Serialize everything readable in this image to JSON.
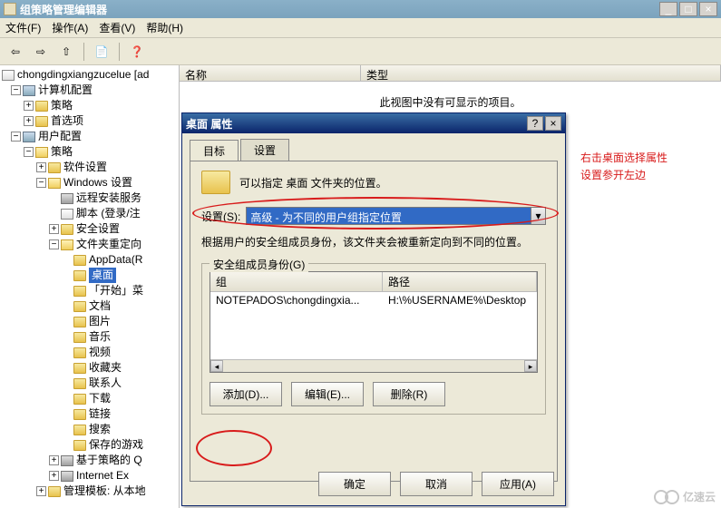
{
  "app": {
    "title": "组策略管理编辑器"
  },
  "menu": {
    "file": "文件(F)",
    "action": "操作(A)",
    "view": "查看(V)",
    "help": "帮助(H)"
  },
  "tree": {
    "root": "chongdingxiangzucelue [ad",
    "computer_cfg": "计算机配置",
    "policies1": "策略",
    "prefs1": "首选项",
    "user_cfg": "用户配置",
    "policies2": "策略",
    "software": "软件设置",
    "windows": "Windows 设置",
    "remoteinst": "远程安装服务",
    "scripts": "脚本 (登录/注",
    "security": "安全设置",
    "folderredir": "文件夹重定向",
    "appdata": "AppData(R",
    "desktop": "桌面",
    "startmenu": "「开始」菜",
    "docs": "文档",
    "pictures": "图片",
    "music": "音乐",
    "videos": "视频",
    "favorites": "收藏夹",
    "contacts": "联系人",
    "downloads": "下载",
    "links": "链接",
    "searches": "搜索",
    "savedgames": "保存的游戏",
    "policyqos": "基于策略的 Q",
    "ie": "Internet Ex",
    "admin": "管理模板: 从本地"
  },
  "list": {
    "col_name": "名称",
    "col_type": "类型",
    "empty": "此视图中没有可显示的项目。"
  },
  "dlg": {
    "title": "桌面 属性",
    "tab_target": "目标",
    "tab_settings": "设置",
    "hdr_text": "可以指定 桌面 文件夹的位置。",
    "setting_label": "设置(S):",
    "select_value": "高级 - 为不同的用户组指定位置",
    "desc": "根据用户的安全组成员身份，该文件夹会被重新定向到不同的位置。",
    "fieldset": "安全组成员身份(G)",
    "col_group": "组",
    "col_path": "路径",
    "row_group": "NOTEPADOS\\chongdingxia...",
    "row_path": "H:\\%USERNAME%\\Desktop",
    "btn_add": "添加(D)...",
    "btn_edit": "编辑(E)...",
    "btn_remove": "删除(R)",
    "btn_ok": "确定",
    "btn_cancel": "取消",
    "btn_apply": "应用(A)"
  },
  "ann": {
    "l1": "右击桌面选择属性",
    "l2": "设置参开左边"
  },
  "wm": "亿速云"
}
